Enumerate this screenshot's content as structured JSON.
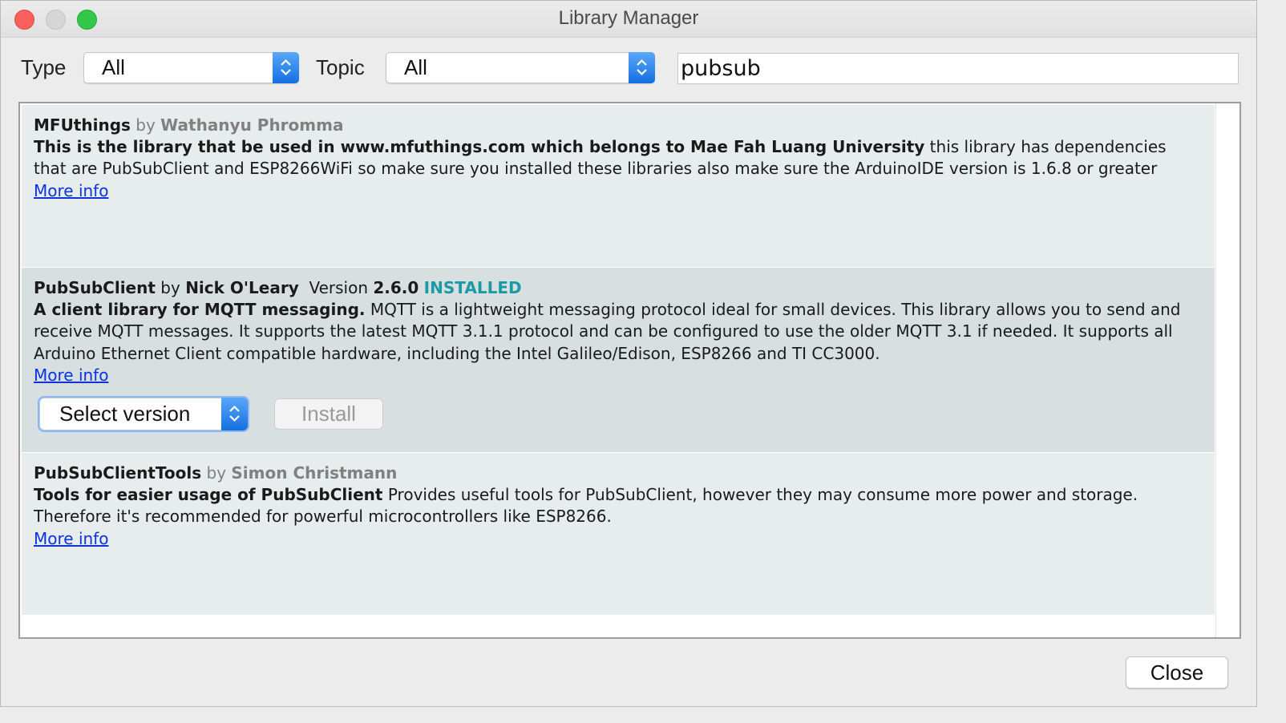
{
  "window": {
    "title": "Library Manager"
  },
  "filters": {
    "type_label": "Type",
    "type_value": "All",
    "topic_label": "Topic",
    "topic_value": "All",
    "search_value": "pubsub"
  },
  "libraries": [
    {
      "name": "MFUthings",
      "by": "by",
      "author": "Wathanyu Phromma",
      "summary": "This is the library that be used in www.mfuthings.com which belongs to Mae Fah Luang University",
      "description": " this library has dependencies that are PubSubClient and ESP8266WiFi so make sure you installed these libraries also make sure the ArduinoIDE version is 1.6.8 or greater",
      "more_info": "More info"
    },
    {
      "name": "PubSubClient",
      "by": "by",
      "author": "Nick O'Leary",
      "version_label": "Version",
      "version": "2.6.0",
      "status": "INSTALLED",
      "summary": "A client library for MQTT messaging.",
      "description": " MQTT is a lightweight messaging protocol ideal for small devices. This library allows you to send and receive MQTT messages. It supports the latest MQTT 3.1.1 protocol and can be configured to use the older MQTT 3.1 if needed. It supports all Arduino Ethernet Client compatible hardware, including the Intel Galileo/Edison, ESP8266 and TI CC3000.",
      "more_info": "More info",
      "select_version": "Select version",
      "install_label": "Install"
    },
    {
      "name": "PubSubClientTools",
      "by": "by",
      "author": "Simon Christmann",
      "summary": "Tools for easier usage of PubSubClient",
      "description": " Provides useful tools for PubSubClient, however they may consume more power and storage. Therefore it's recommended for powerful microcontrollers like ESP8266.",
      "more_info": "More info"
    }
  ],
  "footer": {
    "close_label": "Close"
  },
  "colors": {
    "installed": "#1a9aa5",
    "link": "#0b33e0",
    "select_arrow": "#1470e0",
    "entry_bg": "#e7eced",
    "entry_selected_bg": "#d8dfe0"
  },
  "icons": {
    "window_close": "red-traffic-light",
    "window_minimize": "gray-traffic-light",
    "window_zoom": "green-traffic-light",
    "select_arrows": "up-down-chevron-icon"
  }
}
